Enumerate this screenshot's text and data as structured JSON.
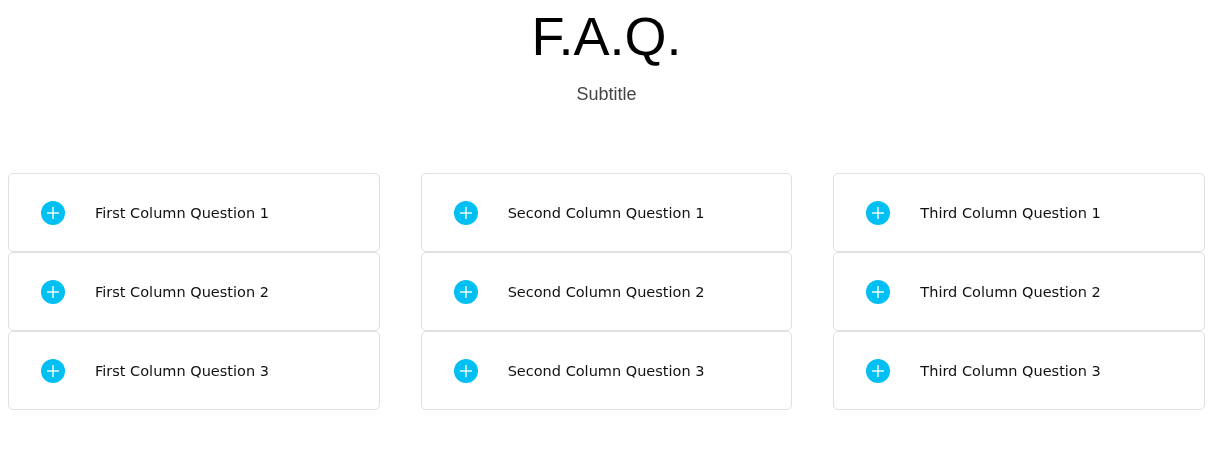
{
  "header": {
    "title": "F.A.Q.",
    "subtitle": "Subtitle"
  },
  "columns": [
    {
      "questions": [
        {
          "text": "First Column Question 1",
          "expanded": false
        },
        {
          "text": "First Column Question 2",
          "expanded": false
        },
        {
          "text": "First Column Question 3",
          "expanded": false
        }
      ]
    },
    {
      "questions": [
        {
          "text": "Second Column Question 1",
          "expanded": false
        },
        {
          "text": "Second Column Question 2",
          "expanded": false
        },
        {
          "text": "Second Column Question 3",
          "expanded": false
        }
      ]
    },
    {
      "questions": [
        {
          "text": "Third Column Question 1",
          "expanded": false
        },
        {
          "text": "Third Column Question 2",
          "expanded": false
        },
        {
          "text": "Third Column Question 3",
          "expanded": false
        }
      ]
    }
  ]
}
